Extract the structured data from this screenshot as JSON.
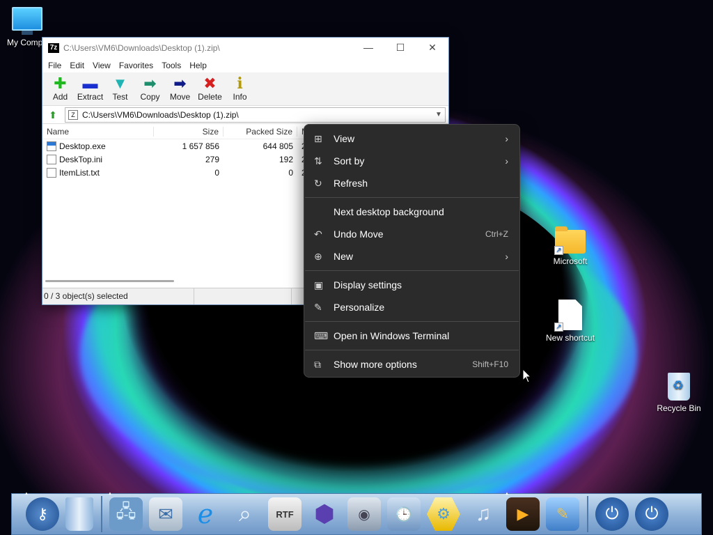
{
  "desktop": {
    "icons": [
      {
        "label": "My Compu"
      },
      {
        "label": "Microsoft"
      },
      {
        "label": "New shortcut"
      },
      {
        "label": "Recycle Bin"
      }
    ]
  },
  "window": {
    "title": "C:\\Users\\VM6\\Downloads\\Desktop (1).zip\\",
    "app_badge": "7z",
    "controls": {
      "minimize": "—",
      "maximize": "☐",
      "close": "✕"
    },
    "menu": [
      "File",
      "Edit",
      "View",
      "Favorites",
      "Tools",
      "Help"
    ],
    "toolbar": [
      {
        "label": "Add",
        "glyph": "✚",
        "color": "#1fb81f"
      },
      {
        "label": "Extract",
        "glyph": "▬",
        "color": "#1a2fd0"
      },
      {
        "label": "Test",
        "glyph": "▼",
        "color": "#1fb3b3"
      },
      {
        "label": "Copy",
        "glyph": "➡",
        "color": "#1f8e6c"
      },
      {
        "label": "Move",
        "glyph": "➡",
        "color": "#101c8a"
      },
      {
        "label": "Delete",
        "glyph": "✖",
        "color": "#d62020"
      },
      {
        "label": "Info",
        "glyph": "i",
        "color": "#b59a00"
      }
    ],
    "address": "C:\\Users\\VM6\\Downloads\\Desktop (1).zip\\",
    "columns": {
      "name": "Name",
      "size": "Size",
      "packed": "Packed Size",
      "modified": "M"
    },
    "files": [
      {
        "name": "Desktop.exe",
        "size": "1 657 856",
        "packed": "644 805",
        "mod": "2"
      },
      {
        "name": "DeskTop.ini",
        "size": "279",
        "packed": "192",
        "mod": "2"
      },
      {
        "name": "ItemList.txt",
        "size": "0",
        "packed": "0",
        "mod": "2"
      }
    ],
    "status": "0 / 3 object(s) selected"
  },
  "context_menu": {
    "groups": [
      [
        {
          "label": "View",
          "icon": "grid-icon",
          "glyph": "⊞",
          "submenu": true
        },
        {
          "label": "Sort by",
          "icon": "sort-icon",
          "glyph": "⇅",
          "submenu": true
        },
        {
          "label": "Refresh",
          "icon": "refresh-icon",
          "glyph": "↻"
        }
      ],
      [
        {
          "label": "Next desktop background",
          "icon": "",
          "glyph": ""
        },
        {
          "label": "Undo Move",
          "icon": "undo-icon",
          "glyph": "↶",
          "shortcut": "Ctrl+Z"
        },
        {
          "label": "New",
          "icon": "new-icon",
          "glyph": "⊕",
          "submenu": true
        }
      ],
      [
        {
          "label": "Display settings",
          "icon": "display-icon",
          "glyph": "▣"
        },
        {
          "label": "Personalize",
          "icon": "brush-icon",
          "glyph": "✎"
        }
      ],
      [
        {
          "label": "Open in Windows Terminal",
          "icon": "terminal-icon",
          "glyph": "⌨"
        }
      ],
      [
        {
          "label": "Show more options",
          "icon": "more-options-icon",
          "glyph": "⧉",
          "shortcut": "Shift+F10"
        }
      ]
    ]
  },
  "dock": {
    "icons": [
      "keys-icon",
      "trash-icon",
      "network-icon",
      "mail-icon",
      "internet-explorer-icon",
      "search-icon",
      "rtf-document-icon",
      "cube-icon",
      "drive-icon",
      "folder-clock-icon",
      "settings-gear-icon",
      "media-icon",
      "film-icon",
      "paint-icon",
      "power-icon",
      "shutdown-icon"
    ]
  }
}
